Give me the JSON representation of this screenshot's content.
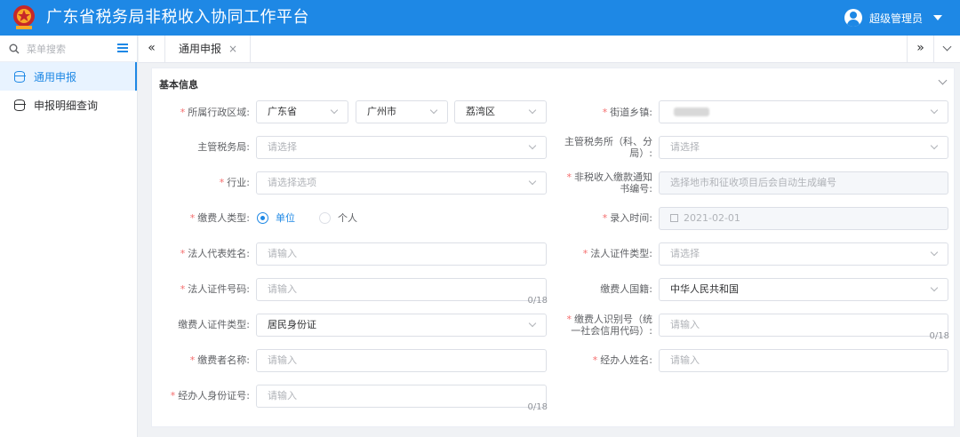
{
  "app": {
    "title": "广东省税务局非税收入协同工作平台",
    "user": "超级管理员"
  },
  "sidebar": {
    "search_placeholder": "菜单搜索",
    "items": [
      {
        "label": "通用申报",
        "active": true
      },
      {
        "label": "申报明细查询",
        "active": false
      }
    ]
  },
  "tabs": {
    "nav_left": "«",
    "nav_right": "»",
    "active_tab": "通用申报",
    "close": "×"
  },
  "form": {
    "section_title": "基本信息",
    "region": {
      "label": "所属行政区域:",
      "province": "广东省",
      "city": "广州市",
      "district": "荔湾区"
    },
    "street": {
      "label": "街道乡镇:"
    },
    "tax_bureau": {
      "label": "主管税务局:",
      "placeholder": "请选择"
    },
    "tax_office": {
      "label_line1": "主管税务所（科、分",
      "label_line2": "局）:",
      "placeholder": "请选择"
    },
    "industry": {
      "label": "行业:",
      "placeholder": "请选择选项"
    },
    "notice_no": {
      "label_line1": "非税收入缴款通知",
      "label_line2": "书编号:",
      "placeholder": "选择地市和征收项目后会自动生成编号"
    },
    "payer_type": {
      "label": "缴费人类型:",
      "option1": "单位",
      "option2": "个人",
      "selected": "单位"
    },
    "entry_time": {
      "label": "录入时间:",
      "value": "2021-02-01"
    },
    "legal_name": {
      "label": "法人代表姓名:",
      "placeholder": "请输入"
    },
    "legal_id_type": {
      "label": "法人证件类型:",
      "placeholder": "请选择"
    },
    "legal_id_no": {
      "label": "法人证件号码:",
      "placeholder": "请输入",
      "count": "0/18"
    },
    "nationality": {
      "label": "缴费人国籍:",
      "value": "中华人民共和国"
    },
    "payer_id_type": {
      "label": "缴费人证件类型:",
      "value": "居民身份证"
    },
    "payer_code": {
      "label_line1": "缴费人识别号（统",
      "label_line2": "一社会信用代码）:",
      "placeholder": "请输入",
      "count": "0/18"
    },
    "payer_name": {
      "label": "缴费者名称:",
      "placeholder": "请输入"
    },
    "handler_name": {
      "label": "经办人姓名:",
      "placeholder": "请输入"
    },
    "handler_id": {
      "label": "经办人身份证号:",
      "placeholder": "请输入",
      "count": "0/18"
    }
  }
}
